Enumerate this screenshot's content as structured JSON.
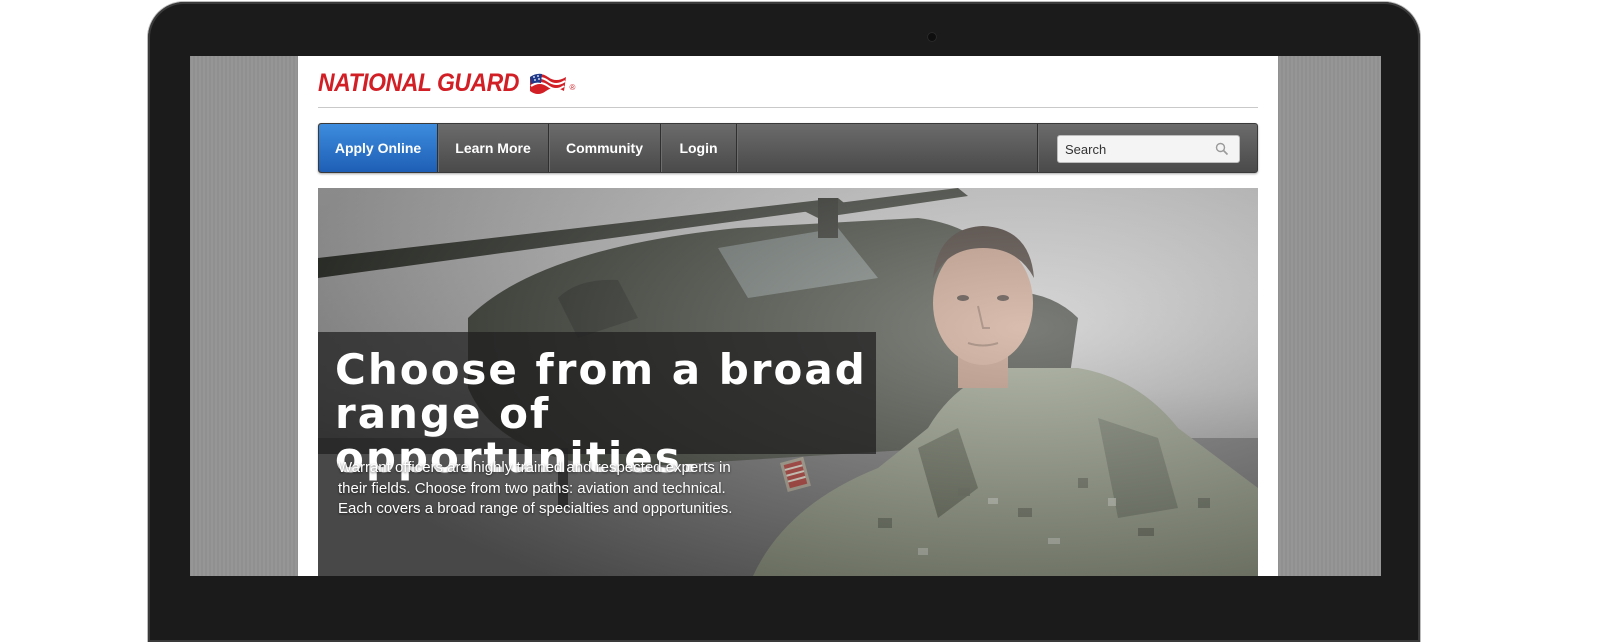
{
  "brand": {
    "logo_text": "NATIONAL GUARD",
    "registered_mark": "®",
    "logo_color": "#d21f26",
    "flag_icon": "american-flag-icon"
  },
  "nav": {
    "items": [
      {
        "label": "Apply Online",
        "active": true
      },
      {
        "label": "Learn More",
        "active": false
      },
      {
        "label": "Community",
        "active": false
      },
      {
        "label": "Login",
        "active": false
      }
    ],
    "active_color": "#2a74cc"
  },
  "search": {
    "placeholder": "Search",
    "icon": "search-icon"
  },
  "hero": {
    "headline_line1": "Choose from a broad",
    "headline_line2": "range of opportunities.",
    "body": "Warrant officers are highly trained and respected experts in their fields. Choose from two paths: aviation and technical. Each covers a broad range of specialties and opportunities.",
    "image": "soldier-with-helicopter-photo"
  }
}
